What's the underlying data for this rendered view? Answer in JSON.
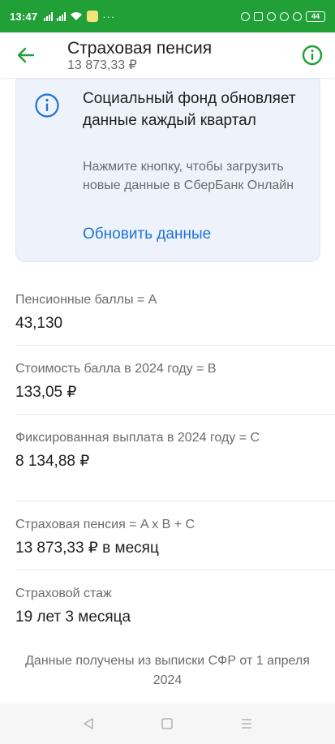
{
  "status_bar": {
    "time": "13:47",
    "battery": "44",
    "more": "···",
    "colors": {
      "background": "#21a038"
    }
  },
  "app_bar": {
    "title": "Страховая пенсия",
    "subtitle": "13 873,33 ₽",
    "back_icon": "arrow-left-icon",
    "info_icon": "info-circle-icon",
    "accent": "#21a038"
  },
  "info_card": {
    "icon": "info-circle-icon",
    "title": "Социальный фонд обновляет данные каждый квартал",
    "text": "Нажмите кнопку, чтобы загрузить новые данные в СберБанк Онлайн",
    "link": "Обновить данные",
    "link_color": "#1f73d6"
  },
  "items": [
    {
      "label": "Пенсионные баллы = A",
      "value": "43,130"
    },
    {
      "label": "Стоимость балла в 2024 году = B",
      "value": "133,05 ₽"
    },
    {
      "label": "Фиксированная выплата в 2024 году = C",
      "value": "8 134,88 ₽"
    },
    {
      "label": "Страховая пенсия = A x B + C",
      "value": "13 873,33 ₽ в месяц"
    },
    {
      "label": "Страховой стаж",
      "value": "19 лет 3 месяца"
    }
  ],
  "footer_note": "Данные получены из выписки СФР от 1 апреля 2024",
  "nav_bar": {
    "back": "triangle-back-icon",
    "home": "square-home-icon",
    "menu": "hamburger-menu-icon"
  }
}
